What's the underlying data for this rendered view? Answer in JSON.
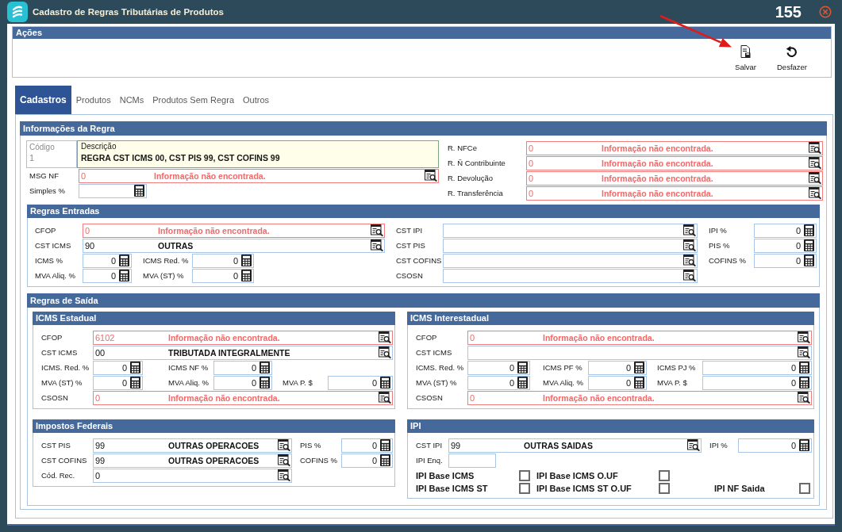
{
  "window": {
    "title": "Cadastro de Regras Tributárias de Produtos",
    "record_number": "155"
  },
  "annotation": {
    "kind": "arrow"
  },
  "actions": {
    "title": "Ações",
    "buttons": [
      {
        "label": "Salvar",
        "kind": "save"
      },
      {
        "label": "Desfazer",
        "kind": "undo"
      }
    ]
  },
  "tabs": [
    {
      "label": "Cadastros",
      "selected": true
    },
    {
      "label": "Produtos",
      "selected": false
    },
    {
      "label": "NCMs",
      "selected": false
    },
    {
      "label": "Produtos Sem Regra",
      "selected": false
    },
    {
      "label": "Outros",
      "selected": false
    }
  ],
  "rule_info": {
    "title": "Informações da Regra",
    "code": {
      "label": "Código",
      "value": "1",
      "disabled": true
    },
    "description": {
      "label": "Descrição",
      "value": "REGRA CST ICMS 00, CST PIS 99, CST COFINS 99"
    },
    "columns": [
      {
        "rows": [
          {
            "fields": [
              {
                "kind": "lookup",
                "label": "MSG NF",
                "code": "0",
                "description": "Informação não encontrada.",
                "invalid": true
              }
            ]
          },
          {
            "fields": [
              {
                "kind": "number",
                "label": "Simples %",
                "invalid": false
              }
            ]
          }
        ]
      },
      {
        "rows": [
          {
            "fields": [
              {
                "kind": "lookup",
                "label": "R. NFCe",
                "code": "0",
                "description": "Informação não encontrada.",
                "invalid": true
              }
            ]
          },
          {
            "fields": [
              {
                "kind": "lookup",
                "label": "R. Ñ Contribuinte",
                "code": "0",
                "description": "Informação não encontrada.",
                "invalid": true
              }
            ]
          },
          {
            "fields": [
              {
                "kind": "lookup",
                "label": "R. Devolução",
                "code": "0",
                "description": "Informação não encontrada.",
                "invalid": true
              }
            ]
          },
          {
            "fields": [
              {
                "kind": "lookup",
                "label": "R. Transferência",
                "code": "0",
                "description": "Informação não encontrada.",
                "invalid": true
              }
            ]
          }
        ]
      }
    ]
  },
  "entry_rules": {
    "title": "Regras Entradas",
    "columns": [
      {
        "rows": [
          {
            "fields": [
              {
                "kind": "lookup",
                "label": "CFOP",
                "code": "0",
                "description": "Informação não encontrada.",
                "invalid": true
              }
            ]
          },
          {
            "fields": [
              {
                "kind": "lookup",
                "label": "CST ICMS",
                "code": "90",
                "description": "OUTRAS",
                "invalid": false
              }
            ]
          },
          {
            "fields": [
              {
                "kind": "number",
                "label": "ICMS %",
                "value": "0",
                "invalid": false
              },
              {
                "kind": "number",
                "label": "ICMS Red. %",
                "value": "0",
                "invalid": false
              }
            ]
          },
          {
            "fields": [
              {
                "kind": "number",
                "label": "MVA Aliq. %",
                "value": "0",
                "invalid": false
              },
              {
                "kind": "number",
                "label": "MVA (ST) %",
                "value": "0",
                "invalid": false
              }
            ]
          }
        ]
      },
      {
        "rows": [
          {
            "fields": [
              {
                "kind": "lookup",
                "label": "CST IPI",
                "invalid": false
              }
            ]
          },
          {
            "fields": [
              {
                "kind": "lookup",
                "label": "CST PIS",
                "invalid": false
              }
            ]
          },
          {
            "fields": [
              {
                "kind": "lookup",
                "label": "CST COFINS",
                "invalid": false
              }
            ]
          },
          {
            "fields": [
              {
                "kind": "lookup",
                "label": "CSOSN",
                "invalid": false
              }
            ]
          }
        ]
      },
      {
        "rows": [
          {
            "fields": [
              {
                "kind": "number",
                "label": "IPI %",
                "value": "0",
                "invalid": false
              }
            ]
          },
          {
            "fields": [
              {
                "kind": "number",
                "label": "PIS %",
                "value": "0",
                "invalid": false
              }
            ]
          },
          {
            "fields": [
              {
                "kind": "number",
                "label": "COFINS %",
                "value": "0",
                "invalid": false
              }
            ]
          }
        ]
      }
    ]
  },
  "exit_rules": {
    "title": "Regras de Saída",
    "panels": [
      {
        "title": "ICMS Estadual",
        "columns": [
          {
            "rows": [
              {
                "fields": [
                  {
                    "kind": "lookup",
                    "label": "CFOP",
                    "code": "6102",
                    "description": "Informação não encontrada.",
                    "invalid": true
                  }
                ]
              },
              {
                "fields": [
                  {
                    "kind": "lookup",
                    "label": "CST ICMS",
                    "code": "00",
                    "description": "TRIBUTADA INTEGRALMENTE",
                    "invalid": false
                  }
                ]
              },
              {
                "fields": [
                  {
                    "kind": "number",
                    "label": "ICMS. Red. %",
                    "value": "0",
                    "invalid": false
                  },
                  {
                    "kind": "number",
                    "label": "ICMS NF %",
                    "value": "0",
                    "invalid": false
                  }
                ]
              },
              {
                "fields": [
                  {
                    "kind": "number",
                    "label": "MVA (ST) %",
                    "value": "0",
                    "invalid": false
                  },
                  {
                    "kind": "number",
                    "label": "MVA Aliq. %",
                    "value": "0",
                    "invalid": false
                  },
                  {
                    "kind": "number",
                    "label": "MVA P. $",
                    "value": "0",
                    "invalid": false
                  }
                ]
              },
              {
                "fields": [
                  {
                    "kind": "lookup",
                    "label": "CSOSN",
                    "code": "0",
                    "description": "Informação não encontrada.",
                    "invalid": true
                  }
                ]
              }
            ]
          }
        ]
      },
      {
        "title": "ICMS Interestadual",
        "columns": [
          {
            "rows": [
              {
                "fields": [
                  {
                    "kind": "lookup",
                    "label": "CFOP",
                    "code": "0",
                    "description": "Informação não encontrada.",
                    "invalid": true
                  }
                ]
              },
              {
                "fields": [
                  {
                    "kind": "lookup",
                    "label": "CST ICMS",
                    "invalid": false
                  }
                ]
              },
              {
                "fields": [
                  {
                    "kind": "number",
                    "label": "ICMS. Red. %",
                    "value": "0",
                    "invalid": false
                  },
                  {
                    "kind": "number",
                    "label": "ICMS PF %",
                    "value": "0",
                    "invalid": false
                  },
                  {
                    "kind": "number",
                    "label": "ICMS PJ %",
                    "value": "0",
                    "invalid": false
                  }
                ]
              },
              {
                "fields": [
                  {
                    "kind": "number",
                    "label": "MVA (ST) %",
                    "value": "0",
                    "invalid": false
                  },
                  {
                    "kind": "number",
                    "label": "MVA Aliq. %",
                    "value": "0",
                    "invalid": false
                  },
                  {
                    "kind": "number",
                    "label": "MVA P. $",
                    "value": "0",
                    "invalid": false
                  }
                ]
              },
              {
                "fields": [
                  {
                    "kind": "lookup",
                    "label": "CSOSN",
                    "code": "0",
                    "description": "Informação não encontrada.",
                    "invalid": true
                  }
                ]
              }
            ]
          }
        ]
      },
      {
        "title": "Impostos Federais",
        "columns": [
          {
            "rows": [
              {
                "fields": [
                  {
                    "kind": "lookup",
                    "label": "CST PIS",
                    "code": "99",
                    "description": "OUTRAS OPERACOES",
                    "invalid": false
                  }
                ]
              },
              {
                "fields": [
                  {
                    "kind": "lookup",
                    "label": "CST COFINS",
                    "code": "99",
                    "description": "OUTRAS OPERACOES",
                    "invalid": false
                  }
                ]
              },
              {
                "fields": [
                  {
                    "kind": "lookup",
                    "label": "Cód. Rec.",
                    "code": "0",
                    "invalid": false
                  }
                ]
              }
            ]
          },
          {
            "rows": [
              {
                "fields": [
                  {
                    "kind": "number",
                    "label": "PIS %",
                    "value": "0",
                    "invalid": false
                  }
                ]
              },
              {
                "fields": [
                  {
                    "kind": "number",
                    "label": "COFINS %",
                    "value": "0",
                    "invalid": false
                  }
                ]
              }
            ]
          }
        ]
      },
      {
        "title": "IPI",
        "columns": [
          {
            "rows": [
              {
                "fields": [
                  {
                    "kind": "lookup",
                    "label": "CST IPI",
                    "code": "99",
                    "description": "OUTRAS SAIDAS",
                    "invalid": false
                  }
                ]
              },
              {
                "fields": [
                  {
                    "kind": "text",
                    "label": "IPI Enq.",
                    "invalid": false
                  }
                ]
              }
            ]
          },
          {
            "rows": [
              {
                "fields": [
                  {
                    "kind": "number",
                    "label": "IPI %",
                    "value": "0",
                    "invalid": false
                  }
                ]
              }
            ]
          }
        ],
        "checkbox_rows": [
          {
            "items": [
              {
                "label": "IPI Base ICMS",
                "checked": false
              },
              {
                "label": "IPI Base ICMS O.UF",
                "checked": false
              }
            ]
          },
          {
            "items": [
              {
                "label": "IPI Base ICMS ST",
                "checked": false
              },
              {
                "label": "IPI Base ICMS ST O.UF",
                "checked": false
              },
              {
                "label": "IPI NF Saida",
                "checked": false
              }
            ]
          }
        ]
      }
    ]
  }
}
